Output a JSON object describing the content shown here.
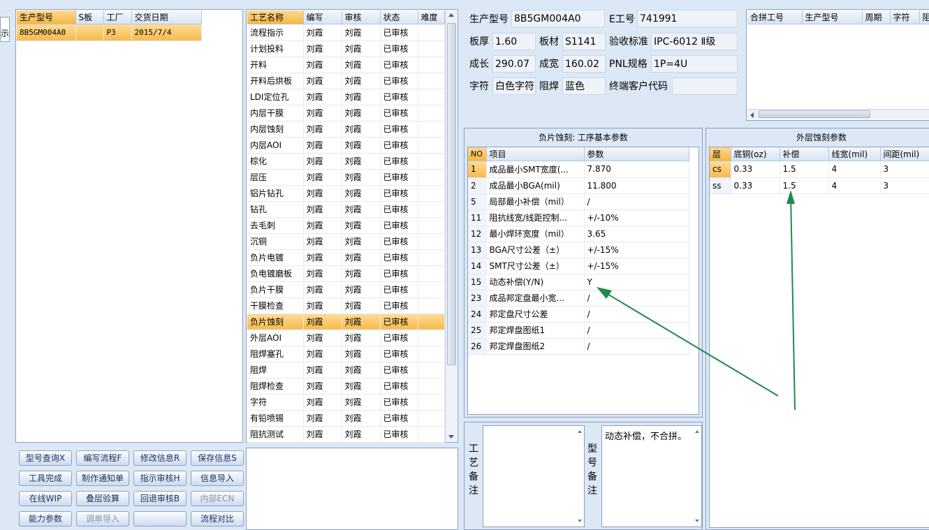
{
  "left_edge_char": "示",
  "order_list": {
    "headers": [
      "生产型号",
      "S板",
      "工厂",
      "交货日期"
    ],
    "rows": [
      [
        "8B5GM004A0",
        "",
        "P3",
        "2015/7/4"
      ]
    ]
  },
  "process_list": {
    "headers": [
      "工艺名称",
      "编写",
      "审核",
      "状态",
      "难度"
    ],
    "rows": [
      [
        "流程指示",
        "刘霞",
        "刘霞",
        "已审核",
        ""
      ],
      [
        "计划投料",
        "刘霞",
        "刘霞",
        "已审核",
        ""
      ],
      [
        "开料",
        "刘霞",
        "刘霞",
        "已审核",
        ""
      ],
      [
        "开料后烘板",
        "刘霞",
        "刘霞",
        "已审核",
        ""
      ],
      [
        "LDI定位孔",
        "刘霞",
        "刘霞",
        "已审核",
        ""
      ],
      [
        "内层干膜",
        "刘霞",
        "刘霞",
        "已审核",
        ""
      ],
      [
        "内层蚀刻",
        "刘霞",
        "刘霞",
        "已审核",
        ""
      ],
      [
        "内层AOI",
        "刘霞",
        "刘霞",
        "已审核",
        ""
      ],
      [
        "棕化",
        "刘霞",
        "刘霞",
        "已审核",
        ""
      ],
      [
        "层压",
        "刘霞",
        "刘霞",
        "已审核",
        ""
      ],
      [
        "铝片钻孔",
        "刘霞",
        "刘霞",
        "已审核",
        ""
      ],
      [
        "钻孔",
        "刘霞",
        "刘霞",
        "已审核",
        ""
      ],
      [
        "去毛刺",
        "刘霞",
        "刘霞",
        "已审核",
        ""
      ],
      [
        "沉铜",
        "刘霞",
        "刘霞",
        "已审核",
        ""
      ],
      [
        "负片电镀",
        "刘霞",
        "刘霞",
        "已审核",
        ""
      ],
      [
        "负电镀磨板",
        "刘霞",
        "刘霞",
        "已审核",
        ""
      ],
      [
        "负片干膜",
        "刘霞",
        "刘霞",
        "已审核",
        ""
      ],
      [
        "干膜检查",
        "刘霞",
        "刘霞",
        "已审核",
        ""
      ],
      [
        "负片蚀刻",
        "刘霞",
        "刘霞",
        "已审核",
        ""
      ],
      [
        "外层AOI",
        "刘霞",
        "刘霞",
        "已审核",
        ""
      ],
      [
        "阻焊塞孔",
        "刘霞",
        "刘霞",
        "已审核",
        ""
      ],
      [
        "阻焊",
        "刘霞",
        "刘霞",
        "已审核",
        ""
      ],
      [
        "阻焊检查",
        "刘霞",
        "刘霞",
        "已审核",
        ""
      ],
      [
        "字符",
        "刘霞",
        "刘霞",
        "已审核",
        ""
      ],
      [
        "有铅喷锡",
        "刘霞",
        "刘霞",
        "已审核",
        ""
      ],
      [
        "阻抗测试",
        "刘霞",
        "刘霞",
        "已审核",
        ""
      ]
    ]
  },
  "buttons": [
    {
      "label": "型号查询X"
    },
    {
      "label": "编写流程F"
    },
    {
      "label": "修改信息R"
    },
    {
      "label": "保存信息S"
    },
    {
      "label": "工具完成"
    },
    {
      "label": "制作通知单"
    },
    {
      "label": "指示审核H"
    },
    {
      "label": "信息导入"
    },
    {
      "label": "在线WIP"
    },
    {
      "label": "叠层验算"
    },
    {
      "label": "回退审核B"
    },
    {
      "label": "内部ECN"
    },
    {
      "label": "能力参数"
    },
    {
      "label": "调单导入"
    },
    {
      "label": ""
    },
    {
      "label": "流程对比"
    }
  ],
  "info": {
    "model_label": "生产型号",
    "model_value": "8B5GM004A0",
    "e_label": "E工号",
    "e_value": "741991",
    "thickness_label": "板厚",
    "thickness_value": "1.60",
    "material_label": "板材",
    "material_value": "S1141",
    "standard_label": "验收标准",
    "standard_value": "IPC-6012 Ⅱ级",
    "length_label": "成长",
    "length_value": "290.07",
    "width_label": "成宽",
    "width_value": "160.02",
    "pnl_label": "PNL规格",
    "pnl_value": "1P=4U",
    "char_label": "字符",
    "char_value": "白色字符",
    "mask_label": "阻焊",
    "mask_value": "蓝色",
    "customer_label": "终端客户代码",
    "customer_value": ""
  },
  "combine_table": {
    "headers": [
      "合拼工号",
      "生产型号",
      "周期",
      "字符",
      "阻焊"
    ]
  },
  "params_panel": {
    "title": "负片蚀刻: 工序基本参数",
    "headers": [
      "NO",
      "项目",
      "参数"
    ],
    "rows": [
      [
        "1",
        "成品最小SMT宽度(...",
        "7.870"
      ],
      [
        "2",
        "成品最小BGA(mil)",
        "11.800"
      ],
      [
        "5",
        "局部最小补偿（mil）",
        "/"
      ],
      [
        "11",
        "阻抗线宽/线距控制...",
        "+/-10%"
      ],
      [
        "12",
        "最小焊环宽度（mil）",
        "3.65"
      ],
      [
        "13",
        "BGA尺寸公差（±）",
        "+/-15%"
      ],
      [
        "14",
        "SMT尺寸公差（±）",
        "+/-15%"
      ],
      [
        "15",
        "动态补偿(Y/N)",
        "Y"
      ],
      [
        "23",
        "成品邦定盘最小宽...",
        "/"
      ],
      [
        "24",
        "邦定盘尺寸公差",
        "/"
      ],
      [
        "25",
        "邦定焊盘图纸1",
        "/"
      ],
      [
        "26",
        "邦定焊盘图纸2",
        "/"
      ]
    ]
  },
  "etch_panel": {
    "title": "外层蚀刻参数",
    "headers": [
      "层",
      "底铜(oz)",
      "补偿",
      "线宽(mil)",
      "间距(mil)"
    ],
    "rows": [
      [
        "cs",
        "0.33",
        "1.5",
        "4",
        "3"
      ],
      [
        "ss",
        "0.33",
        "1.5",
        "4",
        "3"
      ]
    ]
  },
  "remarks": {
    "process_label": "工艺备注",
    "model_label": "型号备注",
    "model_text": "动态补偿，不合拼。"
  },
  "colors": {
    "arrow": "#1f8a4c",
    "highlight": "#f7ba4e",
    "background": "#dde8f6"
  }
}
